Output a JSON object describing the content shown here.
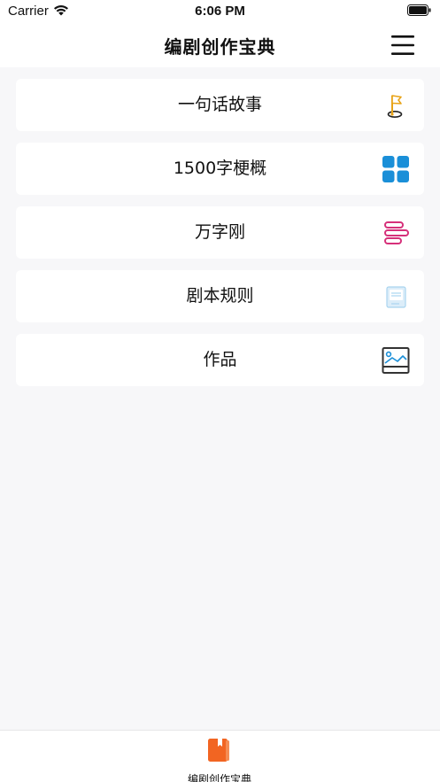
{
  "status_bar": {
    "carrier": "Carrier",
    "time": "6:06 PM"
  },
  "nav": {
    "title": "编剧创作宝典",
    "menu_icon": "hamburger-menu-icon"
  },
  "menu_items": [
    {
      "label": "一句话故事",
      "icon": "flag-pin-icon",
      "icon_color": "#e8a317"
    },
    {
      "label": "1500字梗概",
      "icon": "grid-tiles-icon",
      "icon_color": "#1a8fd8"
    },
    {
      "label": "万字刚",
      "icon": "stacked-bars-icon",
      "icon_color": "#d6307a"
    },
    {
      "label": "剧本规则",
      "icon": "document-icon",
      "icon_color": "#a9d4ef"
    },
    {
      "label": "作品",
      "icon": "picture-frame-icon",
      "icon_color": "#333333"
    }
  ],
  "tab_bar": {
    "label": "编剧创作宝典",
    "icon": "book-icon",
    "icon_color": "#f26522"
  }
}
